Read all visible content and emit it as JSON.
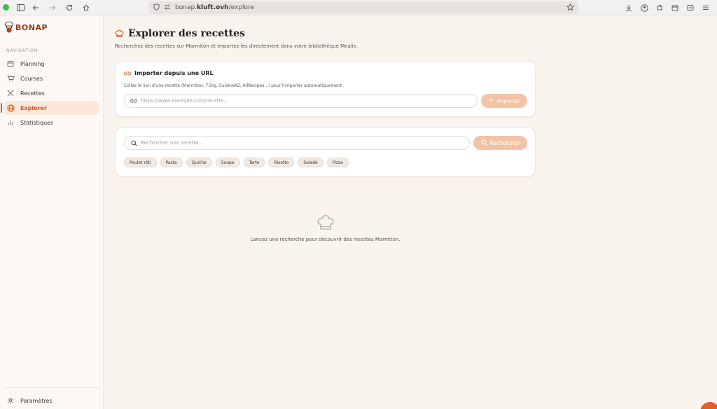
{
  "browser": {
    "url_prefix": "bonap.",
    "url_host": "kluft.ovh",
    "url_path": "/explore"
  },
  "sidebar": {
    "logo_text": "BONAP",
    "nav_title": "NAVIGATION",
    "items": [
      {
        "label": "Planning",
        "icon": "calendar-icon"
      },
      {
        "label": "Courses",
        "icon": "cart-icon"
      },
      {
        "label": "Recettes",
        "icon": "utensils-icon"
      },
      {
        "label": "Explorer",
        "icon": "globe-icon",
        "active": true
      },
      {
        "label": "Statistiques",
        "icon": "bar-chart-icon"
      }
    ],
    "settings_label": "Paramètres"
  },
  "page": {
    "title": "Explorer des recettes",
    "subtitle": "Recherchez des recettes sur Marmiton et importez-les directement dans votre bibliothèque Mealie."
  },
  "import_card": {
    "title": "Importer depuis une URL",
    "description": "Collez le lien d'une recette (Marmiton, 750g, CuisineAZ, AllRecipes...) pour l'importer automatiquement.",
    "placeholder": "https://www.exemple.com/recette...",
    "button_label": "Importer"
  },
  "search_card": {
    "placeholder": "Rechercher une recette...",
    "button_label": "Rechercher",
    "chips": [
      "Poulet rôti",
      "Pasta",
      "Quiche",
      "Soupe",
      "Tarte",
      "Risotto",
      "Salade",
      "Pizza"
    ]
  },
  "empty_state": {
    "message": "Lancez une recherche pour découvrir des recettes Marmiton."
  },
  "colors": {
    "accent": "#d2561f",
    "button_bg": "#f3c3a6",
    "background": "#faf4ef"
  }
}
